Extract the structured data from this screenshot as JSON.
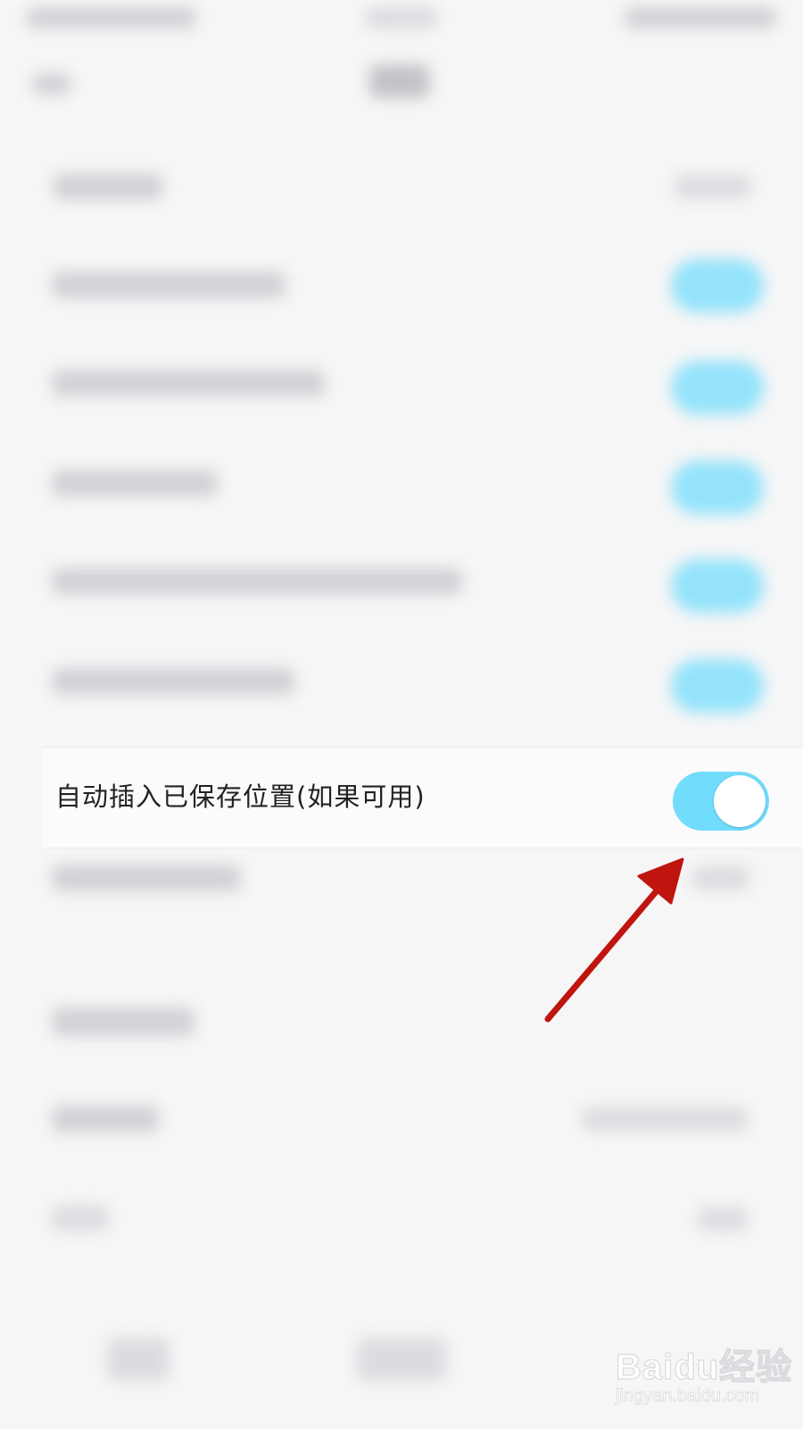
{
  "setting": {
    "label": "自动插入已保存位置(如果可用)",
    "enabled": true
  },
  "colors": {
    "toggle_on": "#71dcfb",
    "annotation_arrow": "#c0140e"
  },
  "watermark": {
    "logo": "Baidu经验",
    "url": "jingyan.baidu.com"
  }
}
